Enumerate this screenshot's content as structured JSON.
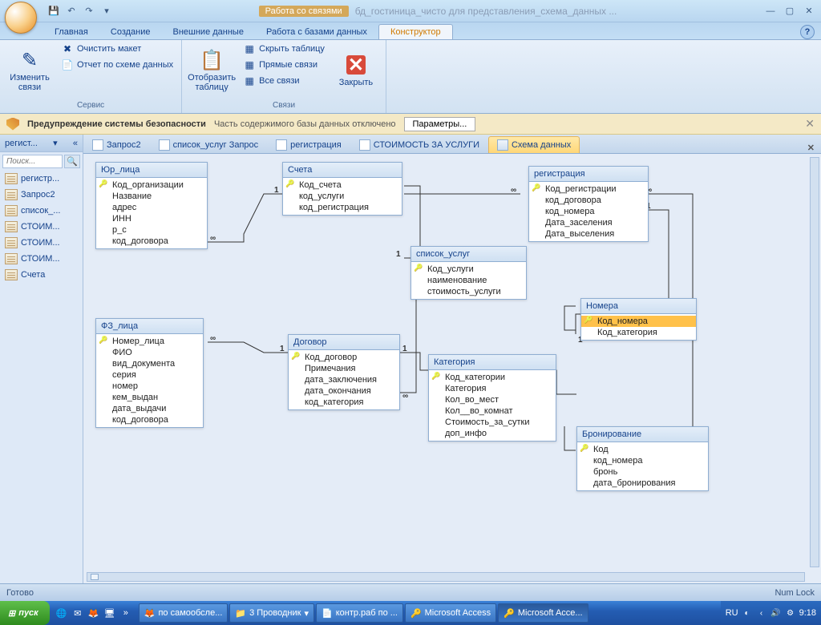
{
  "title": {
    "context_label": "Работа со связями",
    "doc": "бд_гостиница_чисто для представления_схема_данных ..."
  },
  "ribbon_tabs": [
    "Главная",
    "Создание",
    "Внешние данные",
    "Работа с базами данных",
    "Конструктор"
  ],
  "ribbon": {
    "edit_rel": "Изменить связи",
    "clear_layout": "Очистить макет",
    "rel_report": "Отчет по схеме данных",
    "group1": "Сервис",
    "show_table": "Отобразить таблицу",
    "hide_table": "Скрыть таблицу",
    "direct_rel": "Прямые связи",
    "all_rel": "Все связи",
    "group2": "Связи",
    "close": "Закрыть"
  },
  "security": {
    "title": "Предупреждение системы безопасности",
    "msg": "Часть содержимого базы данных отключено",
    "btn": "Параметры..."
  },
  "nav": {
    "header": "регист...",
    "search_ph": "Поиск...",
    "items": [
      "регистр...",
      "Запрос2",
      "список_...",
      "СТОИМ...",
      "СТОИМ...",
      "СТОИМ...",
      "Счета"
    ]
  },
  "doc_tabs": [
    "Запрос2",
    "список_услуг Запрос",
    "регистрация",
    "СТОИМОСТЬ ЗА УСЛУГИ",
    "Схема данных"
  ],
  "tables": {
    "yur": {
      "title": "Юр_лица",
      "fields": [
        "Код_организации",
        "Название",
        "адрес",
        "ИНН",
        "р_с",
        "код_договора"
      ]
    },
    "scheta": {
      "title": "Счета",
      "fields": [
        "Код_счета",
        "код_услуги",
        "код_регистрация"
      ]
    },
    "reg": {
      "title": "регистрация",
      "fields": [
        "Код_регистрации",
        "код_договора",
        "код_номера",
        "Дата_заселения",
        "Дата_выселения"
      ]
    },
    "spisok": {
      "title": "список_услуг",
      "fields": [
        "Код_услуги",
        "наименование",
        "стоимость_услуги"
      ]
    },
    "nomera": {
      "title": "Номера",
      "fields": [
        "Код_номера",
        "Код_категория"
      ]
    },
    "dogovor": {
      "title": "Договор",
      "fields": [
        "Код_договор",
        "Примечания",
        "дата_заключения",
        "дата_окончания",
        "код_категория"
      ]
    },
    "kategoria": {
      "title": "Категория",
      "fields": [
        "Код_категории",
        "Категория",
        "Кол_во_мест",
        "Кол__во_комнат",
        "Стоимость_за_сутки",
        "доп_инфо"
      ]
    },
    "fz": {
      "title": "ФЗ_лица",
      "fields": [
        "Номер_лица",
        "ФИО",
        "вид_документа",
        "серия",
        "номер",
        "кем_выдан",
        "дата_выдачи",
        "код_договора"
      ]
    },
    "bron": {
      "title": "Бронирование",
      "fields": [
        "Код",
        "код_номера",
        "бронь",
        "дата_бронирования"
      ]
    }
  },
  "status": {
    "left": "Готово",
    "right": "Num Lock"
  },
  "taskbar": {
    "start": "пуск",
    "items": [
      "по самообсле...",
      "3 Проводник",
      "контр.раб по ...",
      "Microsoft Access",
      "Microsoft Acce..."
    ],
    "lang": "RU",
    "time": "9:18"
  }
}
